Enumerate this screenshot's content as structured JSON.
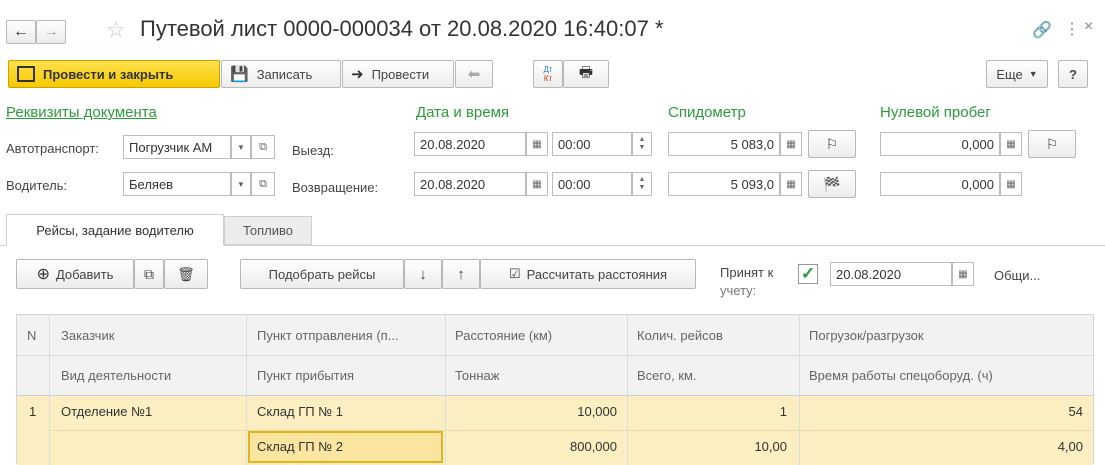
{
  "window": {
    "title": "Путевой лист 0000-000034 от 20.08.2020 16:40:07 *"
  },
  "toolbar": {
    "post_close": "Провести и закрыть",
    "save": "Записать",
    "post": "Провести",
    "more": "Еще",
    "help": "?",
    "dt_kt_top": "Дт",
    "dt_kt_bottom": "Кт"
  },
  "header": {
    "requisites_link": "Реквизиты документа",
    "date_time": "Дата и время",
    "speedometer": "Спидометр",
    "zero_mileage": "Нулевой пробег"
  },
  "form": {
    "vehicle_label": "Автотранспорт:",
    "vehicle_value": "Погрузчик АМ",
    "driver_label": "Водитель:",
    "driver_value": "Беляев",
    "departure_label": "Выезд:",
    "return_label": "Возвращение:",
    "departure_date": "20.08.2020",
    "departure_time": "00:00",
    "return_date": "20.08.2020",
    "return_time": "00:00",
    "speedo_out": "5 083,0",
    "speedo_in": "5 093,0",
    "zero_out": "0,000",
    "zero_in": "0,000"
  },
  "tabs": {
    "trips": "Рейсы, задание водителю",
    "fuel": "Топливо"
  },
  "trip_toolbar": {
    "add": "Добавить",
    "pick_trips": "Подобрать рейсы",
    "calc_distance": "Рассчитать расстояния",
    "accepted_line1": "Принят к",
    "accepted_line2": "учету:",
    "accepted_date": "20.08.2020",
    "common": "Общи..."
  },
  "table": {
    "headers_row1": [
      "N",
      "Заказчик",
      "Пункт отправления (п...",
      "Расстояние (км)",
      "Колич. рейсов",
      "Погрузок/разгрузок"
    ],
    "headers_row2": [
      "",
      "Вид деятельности",
      "Пункт прибытия",
      "Тоннаж",
      "Всего, км.",
      "Время работы спецоборуд. (ч)"
    ],
    "row1": {
      "n": "1",
      "customer": "Отделение №1",
      "from": "Склад ГП № 1",
      "distance": "10,000",
      "trips": "1",
      "loads": "54"
    },
    "row2": {
      "to": "Склад ГП № 2",
      "tonnage": "800,000",
      "total_km": "10,00",
      "equip_hours": "4,00"
    }
  }
}
